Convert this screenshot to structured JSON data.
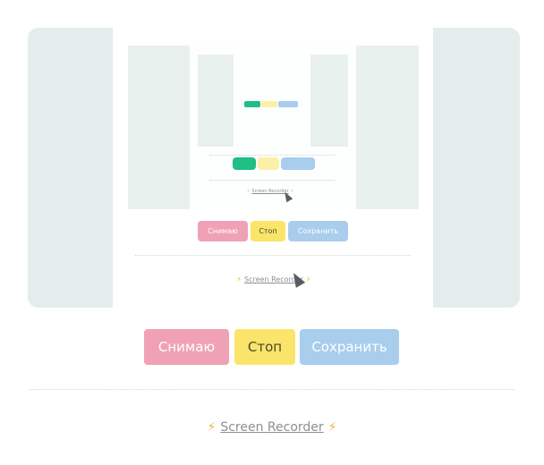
{
  "controls": {
    "record_label": "Снимаю",
    "stop_label": "Стоп",
    "save_label": "Сохранить"
  },
  "footer": {
    "bolt_left": "⚡",
    "link_text": "Screen Recorder",
    "bolt_right": "⚡"
  },
  "colors": {
    "record": "#f0a1b6",
    "stop": "#fbe46a",
    "save": "#a9cdec",
    "record_active": "#1fbf86",
    "preview_bg": "#e9f1ef"
  }
}
